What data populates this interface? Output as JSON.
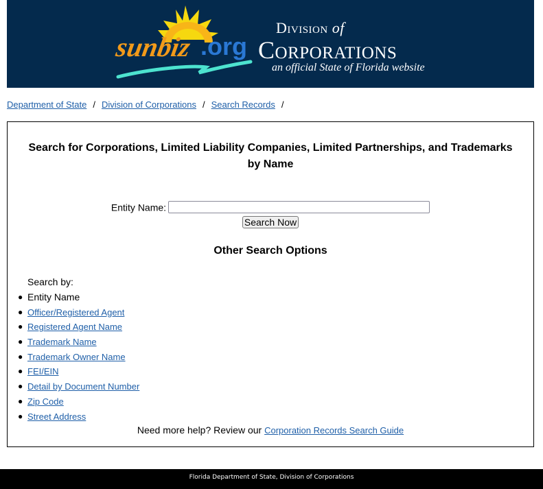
{
  "header": {
    "logo_text": "sunbiz",
    "logo_domain": ".org",
    "division_prefix": "Division",
    "division_of": "of",
    "division_name": "Corporations",
    "tagline": "an official State of Florida website"
  },
  "breadcrumb": [
    {
      "label": "Department of State"
    },
    {
      "label": "Division of Corporations"
    },
    {
      "label": "Search Records"
    }
  ],
  "breadcrumb_separator": "/",
  "main": {
    "title_line1": "Search for Corporations, Limited Liability Companies, Limited Partnerships, and Trademarks",
    "title_line2": "by Name",
    "entity_label": "Entity Name:",
    "entity_value": "",
    "entity_placeholder": "",
    "search_button": "Search Now",
    "other_title": "Other Search Options",
    "search_by": "Search by:",
    "options": [
      {
        "label": "Entity Name",
        "link": false
      },
      {
        "label": "Officer/Registered Agent",
        "link": true
      },
      {
        "label": "Registered Agent Name",
        "link": true
      },
      {
        "label": "Trademark Name",
        "link": true
      },
      {
        "label": "Trademark Owner Name",
        "link": true
      },
      {
        "label": "FEI/EIN",
        "link": true
      },
      {
        "label": "Detail by Document Number",
        "link": true
      },
      {
        "label": "Zip Code",
        "link": true
      },
      {
        "label": "Street Address",
        "link": true
      }
    ],
    "help_text": "Need more help? Review our",
    "help_link": "Corporation Records Search Guide"
  },
  "footer": {
    "text": "Florida Department of State, Division of Corporations"
  },
  "colors": {
    "header_bg": "#042a4d",
    "link": "#1f5fa8",
    "footer_bg": "#000000"
  }
}
